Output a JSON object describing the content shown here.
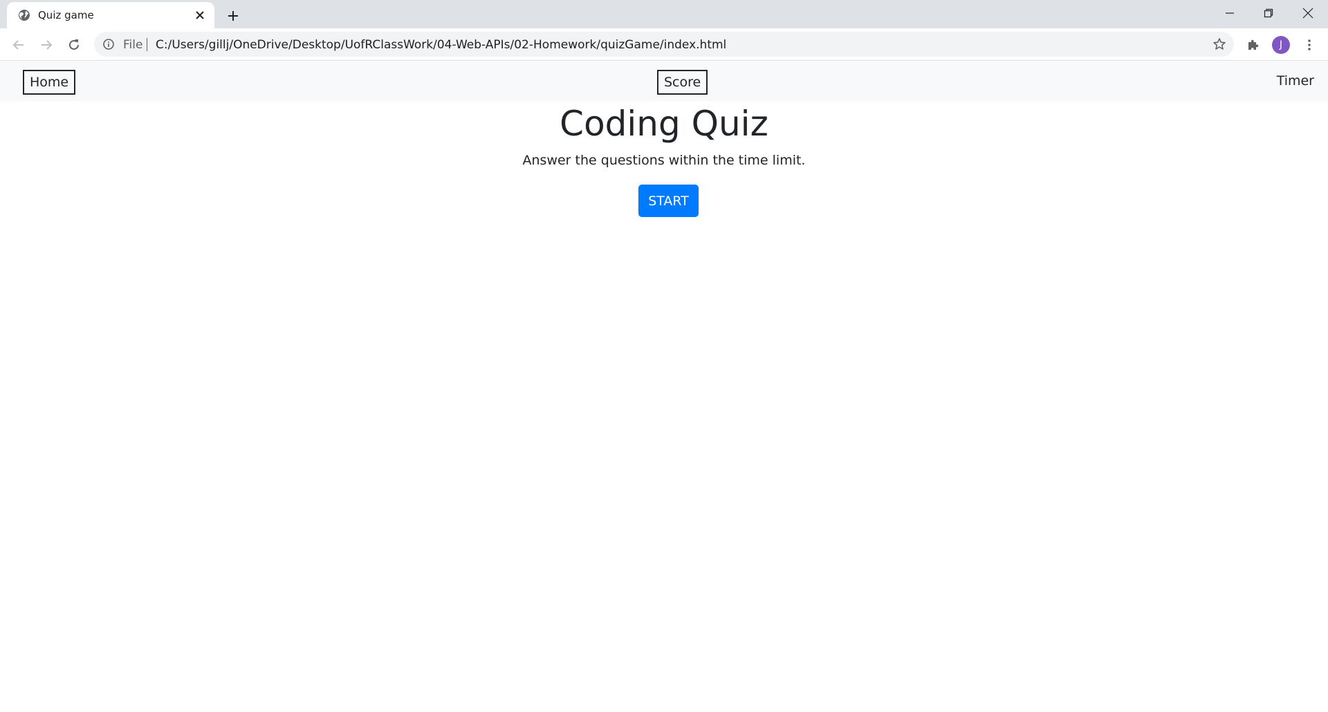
{
  "browser": {
    "tab_title": "Quiz game",
    "url_scheme_label": "File",
    "url": "C:/Users/gillj/OneDrive/Desktop/UofRClassWork/04-Web-APIs/02-Homework/quizGame/index.html",
    "avatar_initial": "J",
    "avatar_color": "#7e57c2"
  },
  "nav": {
    "home_label": "Home",
    "score_label": "Score",
    "timer_label": "Timer"
  },
  "main": {
    "title": "Coding Quiz",
    "subtitle": "Answer the questions within the time limit.",
    "start_label": "START",
    "start_color": "#007bff"
  }
}
